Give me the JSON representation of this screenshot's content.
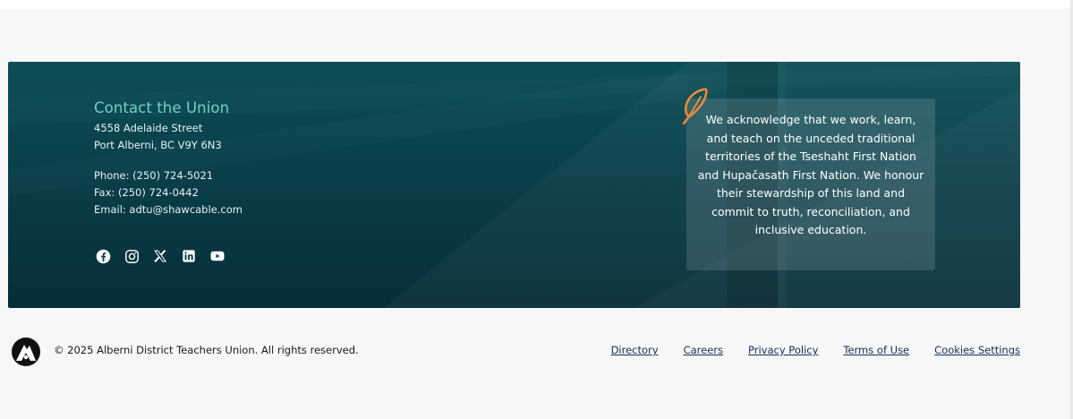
{
  "contact": {
    "title": "Contact the Union",
    "address_line1": "4558 Adelaide Street",
    "address_line2": "Port Alberni, BC V9Y 6N3",
    "phone": "Phone: (250) 724-5021",
    "fax": "Fax: (250) 724-0442",
    "email": "Email: adtu@shawcable.com"
  },
  "social_links": [
    {
      "icon": "facebook-icon"
    },
    {
      "icon": "instagram-icon"
    },
    {
      "icon": "x-twitter-icon"
    },
    {
      "icon": "linkedin-icon"
    },
    {
      "icon": "youtube-icon"
    }
  ],
  "acknowledgement": {
    "icon": "feather-icon",
    "text": "We acknowledge that we work, learn, and teach on the unceded traditional territories of the Tseshaht First Nation and Hupačasath First Nation. We honour their stewardship of this land and commit to truth, reconciliation, and inclusive education."
  },
  "footer": {
    "logo_icon": "mountain-logo-icon",
    "copyright": "© 2025 Alberni District Teachers Union. All rights reserved.",
    "links": [
      {
        "label": "Directory"
      },
      {
        "label": "Careers"
      },
      {
        "label": "Privacy Policy"
      },
      {
        "label": "Terms of Use"
      },
      {
        "label": "Cookies Settings"
      }
    ]
  },
  "colors": {
    "banner_dark": "#072e38",
    "banner_mid": "#0c4e57",
    "accent_teal": "#6fd1c4",
    "feather_orange": "#e98a3a",
    "link_navy": "#12325a"
  }
}
